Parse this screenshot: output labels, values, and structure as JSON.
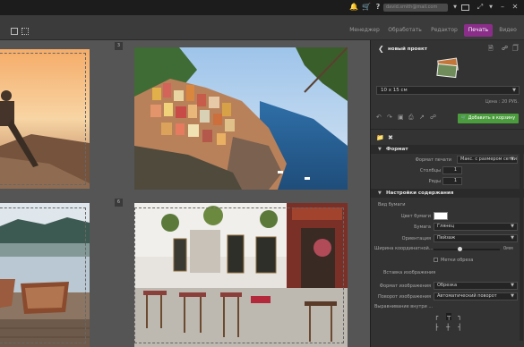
{
  "topbar": {
    "email": "david.smith@mail.com",
    "icons": [
      "bell-icon",
      "cart-icon",
      "help-icon",
      "user-icon",
      "chevron-down-icon",
      "monitor-icon",
      "fullscreen-icon",
      "chevron-down-icon",
      "minimize-icon",
      "close-icon"
    ]
  },
  "tabs": {
    "items": [
      "Менеджер",
      "Обработать",
      "Редактор",
      "Печать",
      "Видео"
    ],
    "active": "Печать"
  },
  "canvas": {
    "page_numbers": [
      "3",
      "6"
    ]
  },
  "panel": {
    "title": "новый проект",
    "size_value": "10 x 15 см",
    "price": "Цена : 20 РУБ.",
    "add_to_cart": "Добавить в корзину",
    "format_section": "Формат",
    "print_format_label": "Формат печати",
    "print_format_value": "Макс. с размером сетки",
    "columns_label": "Столбцы",
    "columns_value": "1",
    "rows_label": "Ряды",
    "rows_value": "1",
    "content_section": "Настройки содержания",
    "paper_view_label": "Вид бумаги",
    "paper_color_label": "Цвет бумаги",
    "paper_color": "#ffffff",
    "paper_label": "Бумага",
    "paper_value": "Глянец",
    "orientation_label": "Ориентация",
    "orientation_value": "Пейзаж",
    "border_width_label": "Ширина координатной...",
    "border_width_value": "0мм",
    "cut_marks_label": "Метки обреза",
    "insert_image_label": "Вставка изображения",
    "image_format_label": "Формат изображения",
    "image_format_value": "Обрезка",
    "image_rotation_label": "Поворот изображения",
    "image_rotation_value": "Автоматический поворот",
    "alignment_label": "Выравнивание внутри ..."
  },
  "colors": {
    "accent": "#8a2e8a",
    "cart_green": "#4a9c3c"
  }
}
